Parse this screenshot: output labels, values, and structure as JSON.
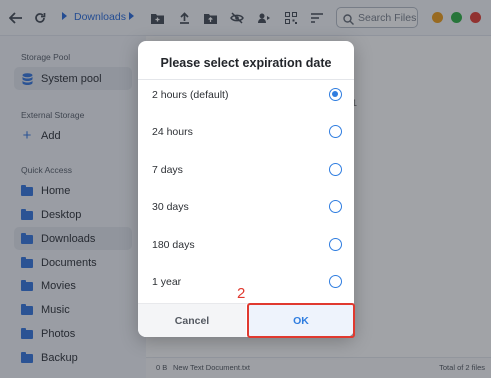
{
  "toolbar": {
    "breadcrumb": "Downloads",
    "search_placeholder": "Search Files",
    "window_buttons": {
      "minimize": "#f0a020",
      "maximize": "#34b34a",
      "close": "#e5443a"
    },
    "icons": [
      "back-icon",
      "refresh-icon",
      "breadcrumb-arrow-icon",
      "new-folder-icon",
      "upload-icon",
      "folder-upload-icon",
      "hide-icon",
      "share-icon",
      "qr-code-icon",
      "sort-icon",
      "search-icon"
    ]
  },
  "sidebar": {
    "storage_pool_header": "Storage Pool",
    "storage_pool_item": "System pool",
    "external_header": "External Storage",
    "external_add": "Add",
    "quick_access_header": "Quick Access",
    "quick_access": [
      {
        "label": "Home"
      },
      {
        "label": "Desktop"
      },
      {
        "label": "Downloads",
        "active": true
      },
      {
        "label": "Documents"
      },
      {
        "label": "Movies"
      },
      {
        "label": "Music"
      },
      {
        "label": "Photos"
      },
      {
        "label": "Backup"
      }
    ]
  },
  "main": {
    "partial_text": "1"
  },
  "statusbar": {
    "size": "0 B",
    "file": "New Text Document.txt",
    "total": "Total of 2 files"
  },
  "dialog": {
    "title": "Please select expiration date",
    "options": [
      {
        "label": "2 hours (default)",
        "selected": true
      },
      {
        "label": "24 hours",
        "selected": false
      },
      {
        "label": "7 days",
        "selected": false
      },
      {
        "label": "30 days",
        "selected": false
      },
      {
        "label": "180 days",
        "selected": false
      },
      {
        "label": "1 year",
        "selected": false
      }
    ],
    "cancel_label": "Cancel",
    "ok_label": "OK"
  },
  "annotation": {
    "step_number": "2",
    "color": "#e0392f"
  },
  "colors": {
    "accent": "#2f7de0",
    "folder": "#3b7be0"
  }
}
